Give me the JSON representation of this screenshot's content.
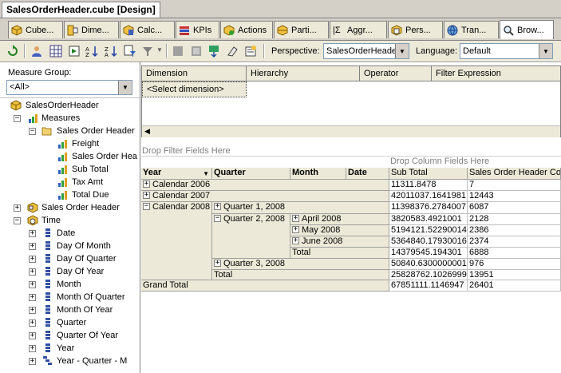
{
  "doc_tab": {
    "title": "SalesOrderHeader.cube [Design]"
  },
  "designer_tabs": [
    {
      "label": "Cube...",
      "icon": "cube-structure-icon"
    },
    {
      "label": "Dime...",
      "icon": "dimension-usage-icon"
    },
    {
      "label": "Calc...",
      "icon": "calculations-icon"
    },
    {
      "label": "KPIs",
      "icon": "kpi-icon"
    },
    {
      "label": "Actions",
      "icon": "actions-icon"
    },
    {
      "label": "Parti...",
      "icon": "partitions-icon"
    },
    {
      "label": "Aggr...",
      "icon": "aggregations-icon"
    },
    {
      "label": "Pers...",
      "icon": "perspectives-icon"
    },
    {
      "label": "Tran...",
      "icon": "translations-icon"
    },
    {
      "label": "Brow...",
      "icon": "browser-icon"
    }
  ],
  "toolbar": {
    "perspective_label": "Perspective:",
    "perspective_value": "SalesOrderHeader",
    "language_label": "Language:",
    "language_value": "Default"
  },
  "measure_group": {
    "label": "Measure Group:",
    "value": "<All>"
  },
  "tree": {
    "root": "SalesOrderHeader",
    "measures": "Measures",
    "folder": "Sales Order Header",
    "measure_items": [
      "Freight",
      "Sales Order Hea",
      "Sub Total",
      "Tax Amt",
      "Total Due"
    ],
    "dimension": "Sales Order Header",
    "time": "Time",
    "time_items": [
      "Date",
      "Day Of Month",
      "Day Of Quarter",
      "Day Of Year",
      "Month",
      "Month Of Quarter",
      "Month Of Year",
      "Quarter",
      "Quarter Of Year",
      "Year",
      "Year - Quarter - M"
    ]
  },
  "filter_grid": {
    "headers": [
      "Dimension",
      "Hierarchy",
      "Operator",
      "Filter Expression"
    ],
    "select_dimension": "<Select dimension>"
  },
  "pivot": {
    "drop_filter": "Drop Filter Fields Here",
    "drop_column": "Drop Column Fields Here",
    "row_headers": [
      "Year",
      "Quarter",
      "Month",
      "Date"
    ],
    "value_headers": [
      "Sub Total",
      "Sales Order Header Cou"
    ],
    "rows": {
      "cal2006": {
        "label": "Calendar 2006",
        "sub": "11311.8478",
        "count": "7"
      },
      "cal2007": {
        "label": "Calendar 2007",
        "sub": "42011037.1641981",
        "count": "12443"
      },
      "cal2008": {
        "label": "Calendar 2008",
        "sub": "11398376.2784007",
        "count": "6087"
      },
      "q1": {
        "label": "Quarter 1, 2008"
      },
      "q2": {
        "label": "Quarter 2, 2008"
      },
      "apr": {
        "label": "April 2008",
        "sub": "3820583.4921001",
        "count": "2128"
      },
      "may": {
        "label": "May 2008",
        "sub": "5194121.52290014",
        "count": "2386"
      },
      "jun": {
        "label": "June 2008",
        "sub": "5364840.17930016",
        "count": "2374"
      },
      "q2total": {
        "label": "Total",
        "sub": "14379545.194301",
        "count": "6888"
      },
      "q3": {
        "label": "Quarter 3, 2008",
        "sub": "50840.6300000001",
        "count": "976"
      },
      "yeartotal": {
        "label": "Total",
        "sub": "25828762.1026999",
        "count": "13951"
      },
      "grand": {
        "label": "Grand Total",
        "sub": "67851111.1146947",
        "count": "26401"
      }
    }
  }
}
